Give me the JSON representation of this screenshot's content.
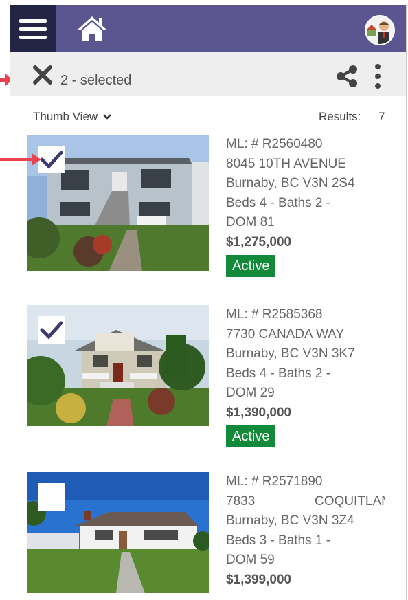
{
  "selection": {
    "text": "2 - selected"
  },
  "view": {
    "label": "Thumb View",
    "results_label": "Results:",
    "results_count": "7"
  },
  "listings": [
    {
      "ml": "ML: # R2560480",
      "street": "8045 10TH AVENUE",
      "city": "Burnaby, BC V3N 2S4",
      "beds_baths": "Beds 4 -  Baths 2 -",
      "dom": "DOM 81",
      "price": "$1,275,000",
      "status": "Active",
      "checked": true
    },
    {
      "ml": "ML: # R2585368",
      "street": "7730 CANADA WAY",
      "city": "Burnaby, BC V3N 3K7",
      "beds_baths": "Beds 4 -  Baths 2 -",
      "dom": "DOM 29",
      "price": "$1,390,000",
      "status": "Active",
      "checked": true
    },
    {
      "ml": "ML: # R2571890",
      "street_num": "7833",
      "street_name": "COQUITLAM",
      "city": "Burnaby, BC V3N 3Z4",
      "beds_baths": "Beds 3 -  Baths 1 -",
      "dom": "DOM 59",
      "price": "$1,399,000",
      "checked": false
    }
  ],
  "colors": {
    "header": "#5b5590",
    "menu": "#242444",
    "status": "#138a3a",
    "arrow": "#e8434f",
    "check": "#3c3a6e"
  }
}
